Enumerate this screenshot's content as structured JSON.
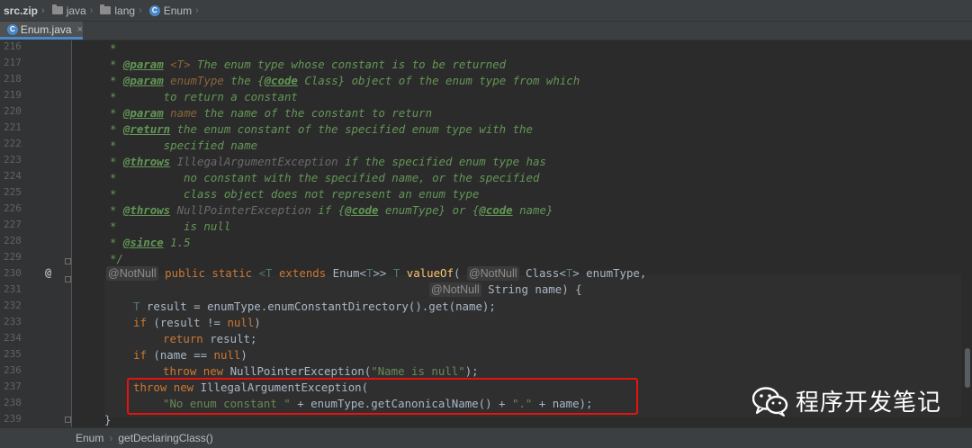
{
  "nav": {
    "archive": "src.zip",
    "crumbs": [
      "java",
      "lang",
      "Enum"
    ]
  },
  "tab": {
    "label": "Enum.java",
    "close": "×"
  },
  "gutter": {
    "line_numbers": [
      "216",
      "217",
      "218",
      "219",
      "220",
      "221",
      "222",
      "223",
      "224",
      "225",
      "226",
      "227",
      "228",
      "229",
      "230",
      "231",
      "232",
      "233",
      "234",
      "235",
      "236",
      "237",
      "238",
      "239"
    ],
    "marker": "@"
  },
  "code": {
    "l216": {
      "star": "*"
    },
    "l217": {
      "star": "* ",
      "tag": "@param",
      "tv": " <T>",
      "rest": " The enum type whose constant is to be returned"
    },
    "l218": {
      "star": "* ",
      "tag": "@param",
      "tv": " enumType",
      "rest1": " the {",
      "tag2": "@code",
      "rest2": " Class} object of the enum type from which"
    },
    "l219": {
      "text": "*       to return a constant"
    },
    "l220": {
      "star": "* ",
      "tag": "@param",
      "tv": " name",
      "rest": " the name of the constant to return"
    },
    "l221": {
      "star": "* ",
      "tag": "@return",
      "rest": " the enum constant of the specified enum type with the"
    },
    "l222": {
      "text": "*       specified name"
    },
    "l223": {
      "star": "* ",
      "tag": "@throws",
      "cls": " IllegalArgumentException",
      "rest": " if the specified enum type has"
    },
    "l224": {
      "text": "*          no constant with the specified name, or the specified"
    },
    "l225": {
      "text": "*          class object does not represent an enum type"
    },
    "l226": {
      "star": "* ",
      "tag": "@throws",
      "cls": " NullPointerException",
      "rest1": " if {",
      "tag2": "@code",
      "rest2": " enumType} or {",
      "tag3": "@code",
      "rest3": " name}"
    },
    "l227": {
      "text": "*          is null"
    },
    "l228": {
      "star": "* ",
      "tag": "@since",
      "rest": " 1.5"
    },
    "l229": {
      "text": "*/"
    },
    "l230": {
      "ann": "@NotNull",
      "kw": " public static ",
      "tp1": "<T",
      "kw2": " extends ",
      "t1": "Enum<",
      "tp2": "T",
      "t2": ">>",
      "tp3": " T",
      "fn": " valueOf",
      "t3": "( ",
      "ann2": "@NotNull",
      "t4": " Class<",
      "tp4": "T",
      "t5": "> enumType,"
    },
    "l231": {
      "ann": "@NotNull",
      "t1": " String name) {"
    },
    "l232": {
      "tp": "T",
      "t1": " result = enumType.enumConstantDirectory().get(name);"
    },
    "l233": {
      "kw": "if",
      "t1": " (result != ",
      "kw2": "null",
      "t2": ")"
    },
    "l234": {
      "kw": "return",
      "t1": " result;"
    },
    "l235": {
      "kw": "if",
      "t1": " (name == ",
      "kw2": "null",
      "t2": ")"
    },
    "l236": {
      "kw": "throw new",
      "t1": " NullPointerException(",
      "str": "\"Name is null\"",
      "t2": ");"
    },
    "l237": {
      "kw": "throw new",
      "t1": " IllegalArgumentException("
    },
    "l238": {
      "str": "\"No enum constant \"",
      "t1": " + enumType.getCanonicalName() + ",
      "str2": "\".\"",
      "t2": " + name);"
    },
    "l239": {
      "t1": "}"
    }
  },
  "watermark": {
    "text": "程序开发笔记"
  },
  "bottom": {
    "crumbs": [
      "Enum",
      "getDeclaringClass()"
    ],
    "sep": "›"
  },
  "colors": {
    "keyword": "#cc7832",
    "comment": "#629755",
    "string": "#6a8759",
    "method": "#ffc66d",
    "highlight_border": "#e8120f",
    "background": "#2b2b2b"
  }
}
